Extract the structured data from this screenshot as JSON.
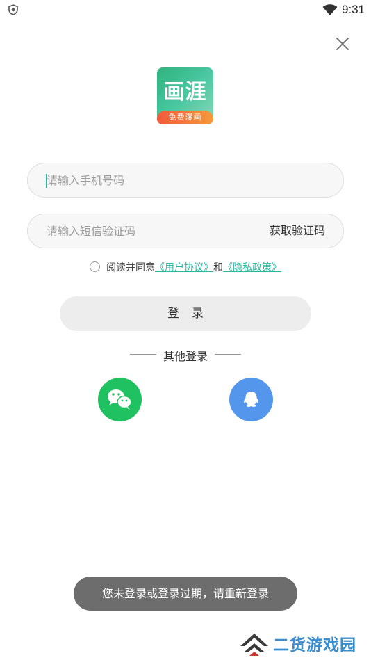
{
  "status_bar": {
    "time": "9:31"
  },
  "logo": {
    "title": "画涯",
    "badge": "免费漫画"
  },
  "phone_input": {
    "placeholder": "请输入手机号码",
    "value": ""
  },
  "code_input": {
    "placeholder": "请输入短信验证码",
    "value": "",
    "get_code_label": "获取验证码"
  },
  "agreement": {
    "prefix": "阅读并同意",
    "user_agreement": "《用户协议》",
    "conjunction": "和",
    "privacy_policy": "《隐私政策》",
    "link_color": "#2cb8a0"
  },
  "login_button": {
    "label": "登录"
  },
  "other_login": {
    "label": "其他登录",
    "options": [
      "wechat-icon",
      "qq-icon"
    ]
  },
  "toast": {
    "message": "您未登录或登录过期，请重新登录"
  },
  "watermark": {
    "text": "二货游戏园"
  },
  "colors": {
    "wechat": "#1fc160",
    "qq": "#5496ec",
    "logo_green": "#2fb37e",
    "badge_orange": "#f25a3c"
  }
}
